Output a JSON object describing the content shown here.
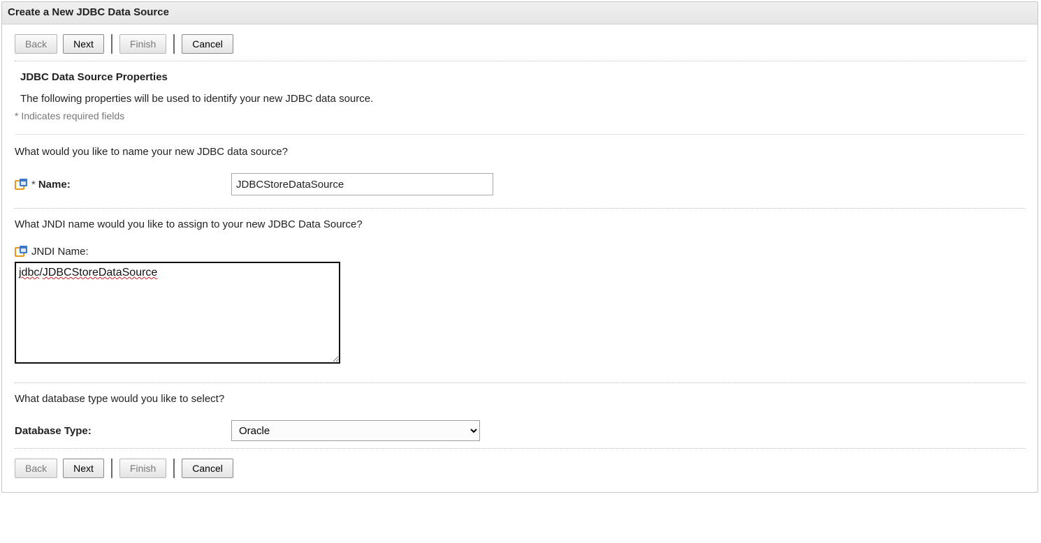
{
  "page": {
    "title": "Create a New JDBC Data Source"
  },
  "buttons": {
    "back": "Back",
    "next": "Next",
    "finish": "Finish",
    "cancel": "Cancel"
  },
  "section": {
    "heading": "JDBC Data Source Properties",
    "intro": "The following properties will be used to identify your new JDBC data source.",
    "required_hint": "* Indicates required fields"
  },
  "name_field": {
    "prompt": "What would you like to name your new JDBC data source?",
    "required_star": "*",
    "label": "Name:",
    "value": "JDBCStoreDataSource"
  },
  "jndi_field": {
    "prompt": "What JNDI name would you like to assign to your new JDBC Data Source?",
    "label": "JNDI Name:",
    "value": "jdbc/JDBCStoreDataSource",
    "spell_tokens": [
      "jdbc",
      "/",
      "JDBCStoreDataSource"
    ],
    "spell_flags": [
      true,
      false,
      true
    ]
  },
  "db_type_field": {
    "prompt": "What database type would you like to select?",
    "label": "Database Type:",
    "selected": "Oracle",
    "options": [
      "Oracle"
    ]
  }
}
